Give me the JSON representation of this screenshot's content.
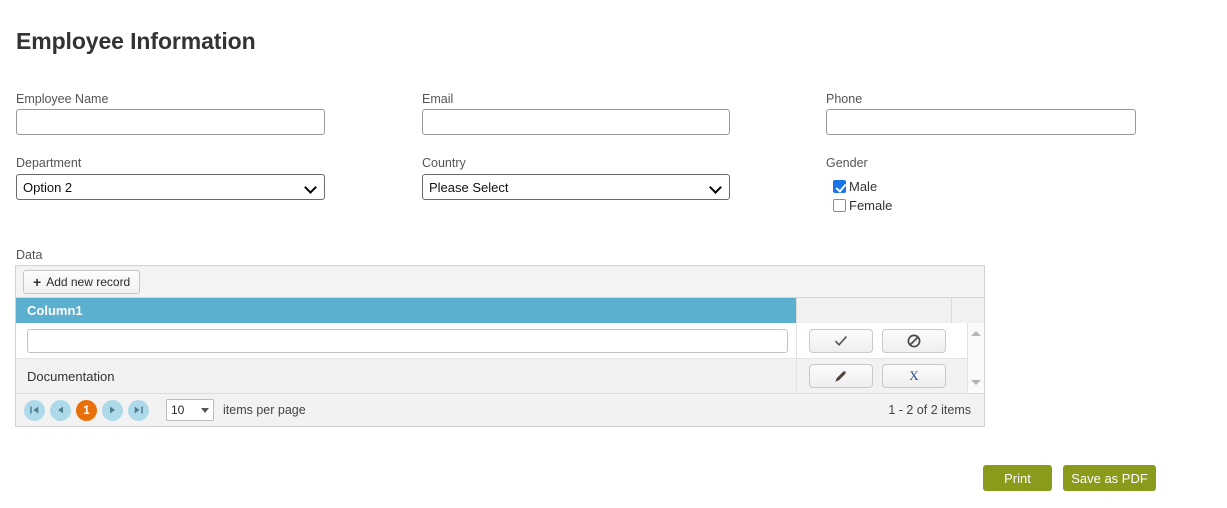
{
  "page": {
    "title": "Employee Information"
  },
  "form": {
    "employee_name": {
      "label": "Employee Name",
      "value": "",
      "placeholder": ""
    },
    "email": {
      "label": "Email",
      "value": "",
      "placeholder": ""
    },
    "phone": {
      "label": "Phone",
      "value": "",
      "placeholder": ""
    },
    "department": {
      "label": "Department",
      "value": "Option 2"
    },
    "country": {
      "label": "Country",
      "value": "Please Select"
    },
    "gender": {
      "label": "Gender",
      "options": [
        {
          "label": "Male",
          "checked": true
        },
        {
          "label": "Female",
          "checked": false
        }
      ]
    }
  },
  "data_grid": {
    "label": "Data",
    "toolbar": {
      "add_label": "Add new record",
      "add_icon": "plus-icon"
    },
    "columns": [
      "Column1"
    ],
    "rows": [
      {
        "mode": "edit",
        "value": "",
        "actions": [
          {
            "name": "update-button",
            "icon": "check-icon"
          },
          {
            "name": "cancel-button",
            "icon": "ban-icon"
          }
        ]
      },
      {
        "mode": "view",
        "value": "Documentation",
        "actions": [
          {
            "name": "edit-button",
            "icon": "pencil-icon"
          },
          {
            "name": "delete-button",
            "icon": "x-icon",
            "label": "X"
          }
        ]
      }
    ],
    "pager": {
      "first_icon": "first-page-icon",
      "prev_icon": "previous-page-icon",
      "current_page": "1",
      "next_icon": "next-page-icon",
      "last_icon": "last-page-icon",
      "page_size": "10",
      "page_size_label": "items per page",
      "info": "1 - 2 of 2 items"
    }
  },
  "footer": {
    "print_label": "Print",
    "save_pdf_label": "Save as PDF"
  },
  "colors": {
    "grid_header": "#5bafcf",
    "pager_active": "#e8700c",
    "pager_button": "#aed9e8",
    "footer_button": "#8a9a1b",
    "checkbox_checked": "#1a73e8"
  }
}
